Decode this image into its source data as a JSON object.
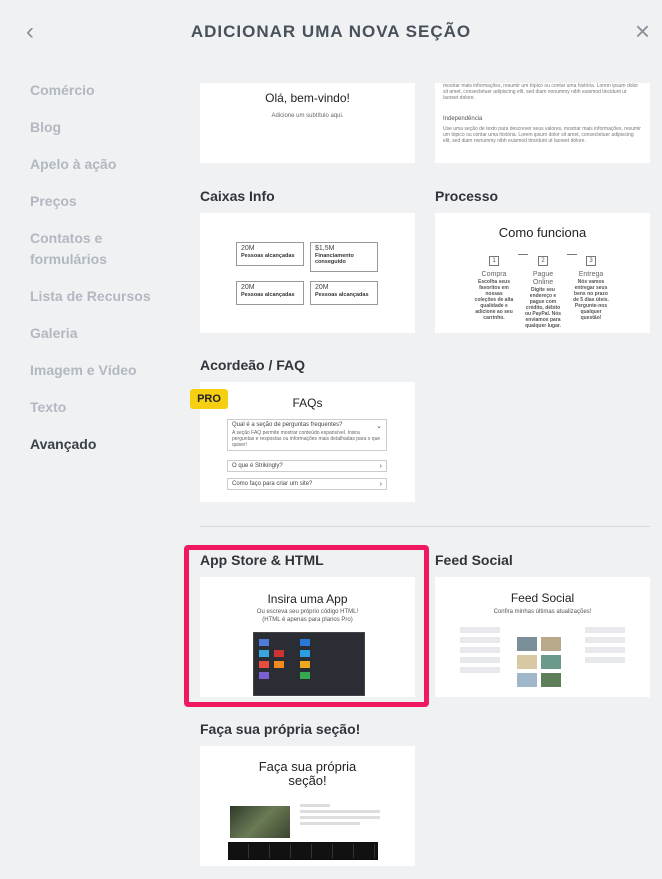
{
  "header": {
    "title": "ADICIONAR UMA NOVA SEÇÃO",
    "back_icon": "‹",
    "close_icon": "×"
  },
  "sidebar": {
    "items": [
      {
        "label": "Comércio",
        "active": false
      },
      {
        "label": "Blog",
        "active": false
      },
      {
        "label": "Apelo à ação",
        "active": false
      },
      {
        "label": "Preços",
        "active": false
      },
      {
        "label": "Contatos e formulários",
        "active": false
      },
      {
        "label": "Lista de Recursos",
        "active": false
      },
      {
        "label": "Galeria",
        "active": false
      },
      {
        "label": "Imagem e Vídeo",
        "active": false
      },
      {
        "label": "Texto",
        "active": false
      },
      {
        "label": "Avançado",
        "active": true
      }
    ]
  },
  "cards": {
    "welcome": {
      "title": "Olá, bem-vindo!",
      "subtitle": "Adicione um subtítulo aqui."
    },
    "text_columns": {
      "para1": "mostrar mais informações, resumir um tópico ou contar uma história. Lorem ipsum dolor sit amet, consectetuer adipiscing elit, sed diam nonummy nibh euismod tincidunt ut laoreet dolore.",
      "heading": "Independência",
      "para2": "Use uma seção de texto para descrever seus valores, mostrar mais informações, resumir um tópico ou contar uma história. Lorem ipsum dolor sit amet, consectetuer adipiscing elit, sed diam nonummy nibh euismod tincidunt ut laoreet dolore."
    },
    "caixas_info": {
      "title": "Caixas Info",
      "boxes": [
        {
          "number": "20M",
          "label": "Pessoas alcançadas"
        },
        {
          "number": "$1,5M",
          "label": "Financiamento conseguido"
        },
        {
          "number": "20M",
          "label": "Pessoas alcançadas"
        },
        {
          "number": "20M",
          "label": "Pessoas alcançadas"
        }
      ]
    },
    "processo": {
      "title": "Processo",
      "heading": "Como funciona",
      "steps": [
        {
          "num": "1",
          "title": "Compra",
          "desc": "Escolha seus favoritos em nossas coleções de alta qualidade e adicione ao seu carrinho."
        },
        {
          "num": "2",
          "title": "Pague Online",
          "desc": "Digite seu endereço e pague com crédito, débito ou PayPal. Nós enviamos para qualquer lugar."
        },
        {
          "num": "3",
          "title": "Entrega",
          "desc": "Nós vamos entregar seus bens no prazo de 5 dias úteis. Pergunte-nos qualquer questão!"
        }
      ]
    },
    "faq": {
      "title": "Acordeão / FAQ",
      "badge": "PRO",
      "heading": "FAQs",
      "q1": "Qual é a seção de perguntas frequentes?",
      "a1": "A seção FAQ permite mostrar conteúdo expansível. Insira perguntas e respostas ou informações mais detalhadas para o que quiser!",
      "q2": "O que é Strikingly?",
      "q3": "Como faço para criar um site?"
    },
    "app_store": {
      "title": "App Store & HTML",
      "heading": "Insira uma App",
      "subtitle": "Ou escreva seu próprio código HTML!",
      "subtitle2": "(HTML é apenas para planos Pro)"
    },
    "feed_social": {
      "title": "Feed Social",
      "heading": "Feed Social",
      "subtitle": "Confira minhas últimas atualizações!"
    },
    "custom": {
      "title": "Faça sua própria seção!",
      "heading": "Faça sua própria seção!"
    }
  },
  "colors": {
    "highlight": "#f0185f",
    "pro_badge": "#f6cf11"
  }
}
